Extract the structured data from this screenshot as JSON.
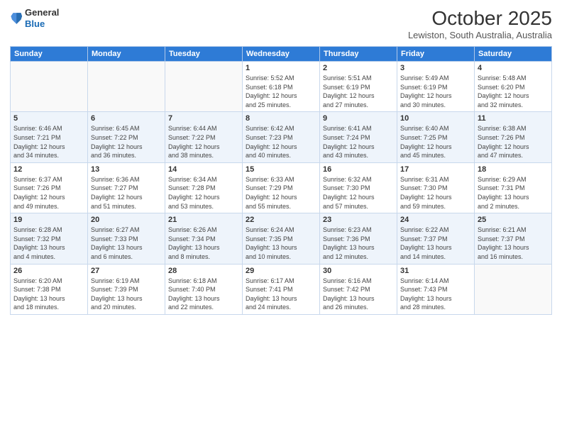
{
  "logo": {
    "general": "General",
    "blue": "Blue"
  },
  "header": {
    "month": "October 2025",
    "location": "Lewiston, South Australia, Australia"
  },
  "days_of_week": [
    "Sunday",
    "Monday",
    "Tuesday",
    "Wednesday",
    "Thursday",
    "Friday",
    "Saturday"
  ],
  "weeks": [
    [
      {
        "day": "",
        "info": ""
      },
      {
        "day": "",
        "info": ""
      },
      {
        "day": "",
        "info": ""
      },
      {
        "day": "1",
        "info": "Sunrise: 5:52 AM\nSunset: 6:18 PM\nDaylight: 12 hours\nand 25 minutes."
      },
      {
        "day": "2",
        "info": "Sunrise: 5:51 AM\nSunset: 6:19 PM\nDaylight: 12 hours\nand 27 minutes."
      },
      {
        "day": "3",
        "info": "Sunrise: 5:49 AM\nSunset: 6:19 PM\nDaylight: 12 hours\nand 30 minutes."
      },
      {
        "day": "4",
        "info": "Sunrise: 5:48 AM\nSunset: 6:20 PM\nDaylight: 12 hours\nand 32 minutes."
      }
    ],
    [
      {
        "day": "5",
        "info": "Sunrise: 6:46 AM\nSunset: 7:21 PM\nDaylight: 12 hours\nand 34 minutes."
      },
      {
        "day": "6",
        "info": "Sunrise: 6:45 AM\nSunset: 7:22 PM\nDaylight: 12 hours\nand 36 minutes."
      },
      {
        "day": "7",
        "info": "Sunrise: 6:44 AM\nSunset: 7:22 PM\nDaylight: 12 hours\nand 38 minutes."
      },
      {
        "day": "8",
        "info": "Sunrise: 6:42 AM\nSunset: 7:23 PM\nDaylight: 12 hours\nand 40 minutes."
      },
      {
        "day": "9",
        "info": "Sunrise: 6:41 AM\nSunset: 7:24 PM\nDaylight: 12 hours\nand 43 minutes."
      },
      {
        "day": "10",
        "info": "Sunrise: 6:40 AM\nSunset: 7:25 PM\nDaylight: 12 hours\nand 45 minutes."
      },
      {
        "day": "11",
        "info": "Sunrise: 6:38 AM\nSunset: 7:26 PM\nDaylight: 12 hours\nand 47 minutes."
      }
    ],
    [
      {
        "day": "12",
        "info": "Sunrise: 6:37 AM\nSunset: 7:26 PM\nDaylight: 12 hours\nand 49 minutes."
      },
      {
        "day": "13",
        "info": "Sunrise: 6:36 AM\nSunset: 7:27 PM\nDaylight: 12 hours\nand 51 minutes."
      },
      {
        "day": "14",
        "info": "Sunrise: 6:34 AM\nSunset: 7:28 PM\nDaylight: 12 hours\nand 53 minutes."
      },
      {
        "day": "15",
        "info": "Sunrise: 6:33 AM\nSunset: 7:29 PM\nDaylight: 12 hours\nand 55 minutes."
      },
      {
        "day": "16",
        "info": "Sunrise: 6:32 AM\nSunset: 7:30 PM\nDaylight: 12 hours\nand 57 minutes."
      },
      {
        "day": "17",
        "info": "Sunrise: 6:31 AM\nSunset: 7:30 PM\nDaylight: 12 hours\nand 59 minutes."
      },
      {
        "day": "18",
        "info": "Sunrise: 6:29 AM\nSunset: 7:31 PM\nDaylight: 13 hours\nand 2 minutes."
      }
    ],
    [
      {
        "day": "19",
        "info": "Sunrise: 6:28 AM\nSunset: 7:32 PM\nDaylight: 13 hours\nand 4 minutes."
      },
      {
        "day": "20",
        "info": "Sunrise: 6:27 AM\nSunset: 7:33 PM\nDaylight: 13 hours\nand 6 minutes."
      },
      {
        "day": "21",
        "info": "Sunrise: 6:26 AM\nSunset: 7:34 PM\nDaylight: 13 hours\nand 8 minutes."
      },
      {
        "day": "22",
        "info": "Sunrise: 6:24 AM\nSunset: 7:35 PM\nDaylight: 13 hours\nand 10 minutes."
      },
      {
        "day": "23",
        "info": "Sunrise: 6:23 AM\nSunset: 7:36 PM\nDaylight: 13 hours\nand 12 minutes."
      },
      {
        "day": "24",
        "info": "Sunrise: 6:22 AM\nSunset: 7:37 PM\nDaylight: 13 hours\nand 14 minutes."
      },
      {
        "day": "25",
        "info": "Sunrise: 6:21 AM\nSunset: 7:37 PM\nDaylight: 13 hours\nand 16 minutes."
      }
    ],
    [
      {
        "day": "26",
        "info": "Sunrise: 6:20 AM\nSunset: 7:38 PM\nDaylight: 13 hours\nand 18 minutes."
      },
      {
        "day": "27",
        "info": "Sunrise: 6:19 AM\nSunset: 7:39 PM\nDaylight: 13 hours\nand 20 minutes."
      },
      {
        "day": "28",
        "info": "Sunrise: 6:18 AM\nSunset: 7:40 PM\nDaylight: 13 hours\nand 22 minutes."
      },
      {
        "day": "29",
        "info": "Sunrise: 6:17 AM\nSunset: 7:41 PM\nDaylight: 13 hours\nand 24 minutes."
      },
      {
        "day": "30",
        "info": "Sunrise: 6:16 AM\nSunset: 7:42 PM\nDaylight: 13 hours\nand 26 minutes."
      },
      {
        "day": "31",
        "info": "Sunrise: 6:14 AM\nSunset: 7:43 PM\nDaylight: 13 hours\nand 28 minutes."
      },
      {
        "day": "",
        "info": ""
      }
    ]
  ]
}
